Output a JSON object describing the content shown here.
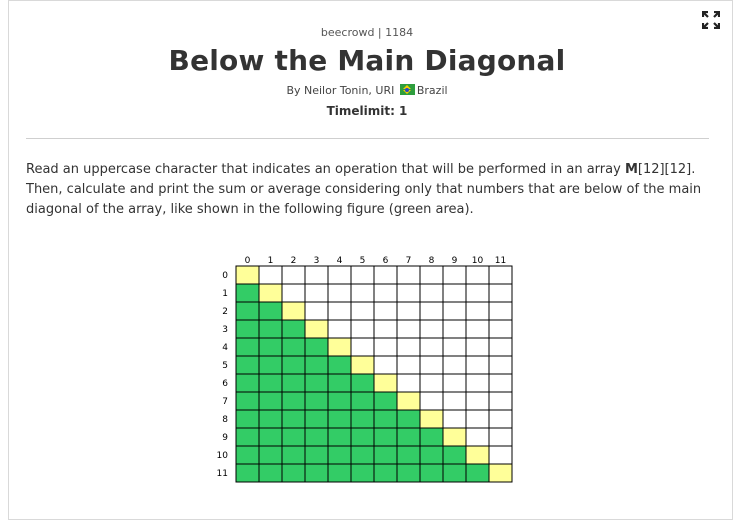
{
  "header": {
    "source": "beecrowd | 1184",
    "title": "Below the Main Diagonal",
    "author_prefix": "By Neilor Tonin, URI",
    "country": "Brazil",
    "timelimit": "Timelimit: 1"
  },
  "toolbar": {
    "expand_icon": "expand-icon"
  },
  "description": {
    "part1": "Read an uppercase character that indicates an operation that will be performed in an array ",
    "array_name": "M",
    "part2": "[12][12]. Then, calculate and print the sum or average considering only that numbers that are below of the main diagonal of the array, like shown in the following figure (green area)."
  },
  "figure": {
    "size": 12,
    "col_labels": [
      "0",
      "1",
      "2",
      "3",
      "4",
      "5",
      "6",
      "7",
      "8",
      "9",
      "10",
      "11"
    ],
    "row_labels": [
      "0",
      "1",
      "2",
      "3",
      "4",
      "5",
      "6",
      "7",
      "8",
      "9",
      "10",
      "11"
    ],
    "colors": {
      "below": "#33cc66",
      "diagonal": "#ffff99",
      "above": "#ffffff",
      "grid": "#000000"
    }
  }
}
